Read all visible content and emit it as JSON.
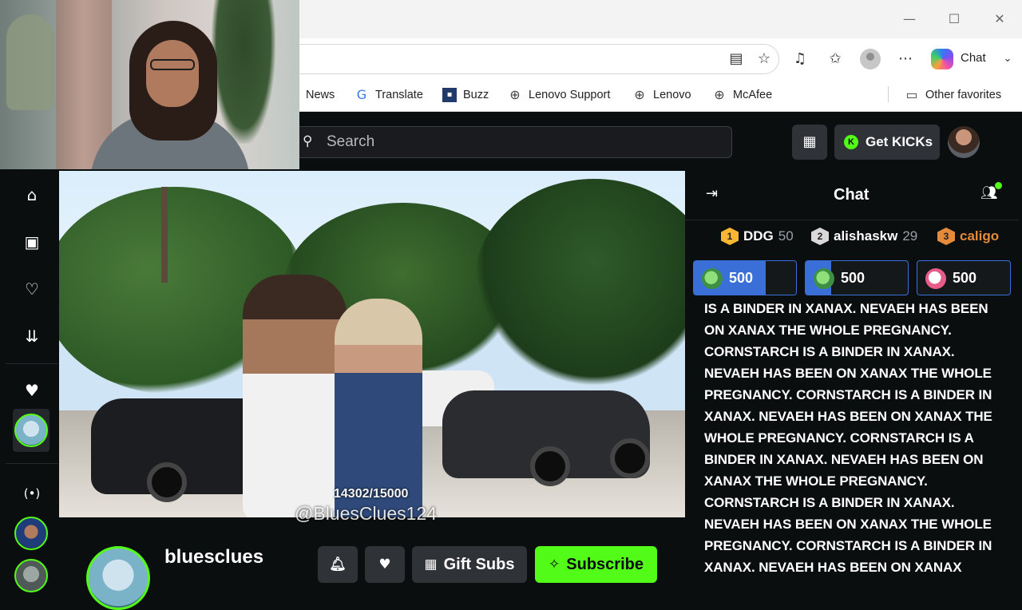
{
  "browser": {
    "window_buttons": [
      "—",
      "☐",
      "✕"
    ],
    "toolbar_icons": [
      "reading-view-icon",
      "favorite-star-icon",
      "media-icon",
      "favorites-icon",
      "profile-icon",
      "more-icon"
    ],
    "copilot_label": "Chat",
    "bookmarks": [
      {
        "label": "News",
        "icon": "news-icon"
      },
      {
        "label": "Translate",
        "icon": "translate-icon"
      },
      {
        "label": "Buzz",
        "icon": "buzz-icon"
      },
      {
        "label": "Lenovo Support",
        "icon": "globe-icon"
      },
      {
        "label": "Lenovo",
        "icon": "globe-icon"
      },
      {
        "label": "McAfee",
        "icon": "globe-icon"
      }
    ],
    "other_favorites": "Other favorites"
  },
  "kick": {
    "search_placeholder": "Search",
    "get_kicks": "Get KICKs",
    "kicks_coin": "K"
  },
  "video": {
    "counter": "14302/15000",
    "handle": "@BluesClues124"
  },
  "channel": {
    "name": "bluesclues",
    "gift_subs": "Gift Subs",
    "subscribe": "Subscribe"
  },
  "chat": {
    "title": "Chat",
    "leaderboard": [
      {
        "rank": "1",
        "name": "DDG",
        "score": "50",
        "color": "#f7b733"
      },
      {
        "rank": "2",
        "name": "alishaskw",
        "score": "29",
        "color": "#d9d9d9"
      },
      {
        "rank": "3",
        "name": "caligo",
        "score": "",
        "color": "#e58a3a"
      }
    ],
    "gifts": [
      {
        "value": "500",
        "fill": 0.7
      },
      {
        "value": "500",
        "fill": 0.25
      },
      {
        "value": "500",
        "fill": 0.0
      }
    ],
    "message": "IS A BINDER IN XANAX. NEVAEH HAS BEEN ON XANAX THE WHOLE PREGNANCY. CORNSTARCH IS A BINDER IN XANAX. NEVAEH HAS BEEN ON XANAX THE WHOLE PREGNANCY. CORNSTARCH IS A BINDER IN XANAX. NEVAEH HAS BEEN ON XANAX THE WHOLE PREGNANCY. CORNSTARCH IS A BINDER IN XANAX. NEVAEH HAS BEEN ON XANAX THE WHOLE PREGNANCY. CORNSTARCH IS A BINDER IN XANAX. NEVAEH HAS BEEN ON XANAX THE WHOLE PREGNANCY. CORNSTARCH IS A BINDER IN XANAX. NEVAEH HAS BEEN ON XANAX"
  },
  "colors": {
    "kick_green": "#53fc18",
    "dark_bg": "#0b0e0f",
    "button_bg": "#2f3237"
  }
}
